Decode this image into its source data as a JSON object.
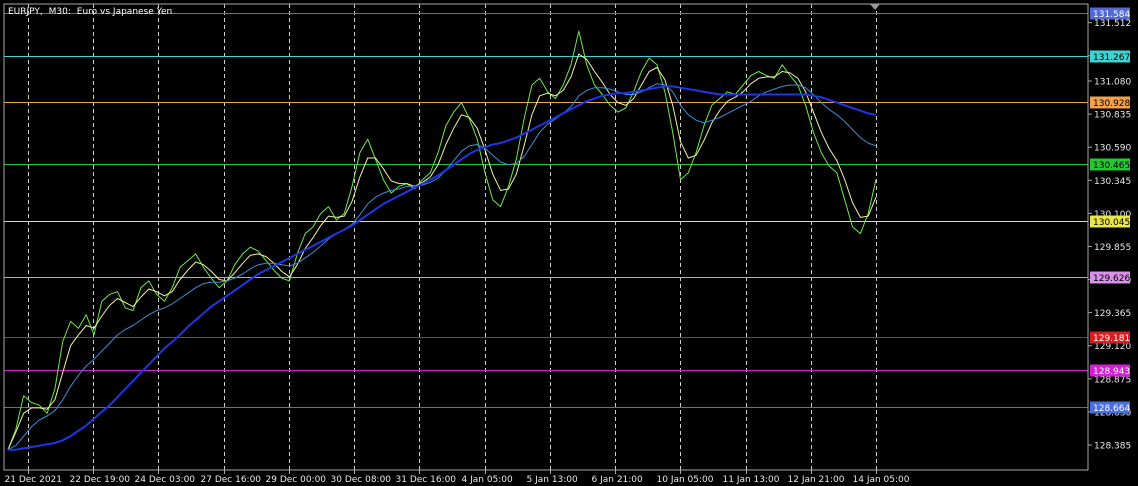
{
  "header": {
    "symbol": "EURJPY,",
    "timeframe": "M30:",
    "description": "Euro vs Japanese Yen"
  },
  "chart_data": {
    "type": "line",
    "ylim": [
      128.2,
      131.65
    ],
    "grid": true,
    "background": "#000000",
    "y_ticks": [
      "131.512",
      "131.267",
      "131.080",
      "130.835",
      "130.590",
      "130.345",
      "130.100",
      "129.855",
      "129.610",
      "129.365",
      "129.120",
      "128.875",
      "128.630",
      "128.385"
    ],
    "x_ticks": [
      "21 Dec 2021",
      "22 Dec 19:00",
      "24 Dec 03:00",
      "27 Dec 16:00",
      "29 Dec 00:00",
      "30 Dec 08:00",
      "31 Dec 16:00",
      "4 Jan 05:00",
      "5 Jan 13:00",
      "6 Jan 21:00",
      "10 Jan 05:00",
      "11 Jan 13:00",
      "12 Jan 21:00",
      "14 Jan 05:00"
    ],
    "levels": [
      {
        "value": 131.584,
        "label": "131.584",
        "color": "#5468d6",
        "text_color": "#ffffff"
      },
      {
        "value": 131.267,
        "label": "131.267",
        "color": "#3fd3d3",
        "text_color": "#000000"
      },
      {
        "value": 130.928,
        "label": "130.928",
        "color": "#f3a14a",
        "text_color": "#000000"
      },
      {
        "value": 130.465,
        "label": "130.465",
        "color": "#27c634",
        "text_color": "#000000"
      },
      {
        "value": 130.045,
        "label": "130.045",
        "color": "#e8e64a",
        "text_color": "#000000"
      },
      {
        "value": 129.626,
        "label": "129.626",
        "color": "#d892ea",
        "text_color": "#000000"
      },
      {
        "value": 129.181,
        "label": "129.181",
        "color": "#d42020",
        "text_color": "#ffffff"
      },
      {
        "value": 128.943,
        "label": "128.943",
        "color": "#d61ed6",
        "text_color": "#ffffff"
      },
      {
        "value": 128.664,
        "label": "128.664",
        "color": "#4a6ee0",
        "text_color": "#ffffff"
      }
    ],
    "series": [
      {
        "color": "#6ee84a",
        "values": [
          128.35,
          128.5,
          128.75,
          128.7,
          128.68,
          128.62,
          128.8,
          129.15,
          129.3,
          129.25,
          129.35,
          129.2,
          129.45,
          129.5,
          129.52,
          129.4,
          129.38,
          129.55,
          129.6,
          129.5,
          129.45,
          129.55,
          129.7,
          129.75,
          129.8,
          129.7,
          129.62,
          129.55,
          129.6,
          129.72,
          129.8,
          129.85,
          129.82,
          129.75,
          129.68,
          129.62,
          129.6,
          129.8,
          129.95,
          130.0,
          130.1,
          130.15,
          130.05,
          130.1,
          130.3,
          130.55,
          130.65,
          130.5,
          130.35,
          130.25,
          130.3,
          130.32,
          130.28,
          130.35,
          130.4,
          130.55,
          130.75,
          130.85,
          130.92,
          130.8,
          130.65,
          130.4,
          130.2,
          130.15,
          130.3,
          130.5,
          130.8,
          131.05,
          131.1,
          131.0,
          130.95,
          131.05,
          131.2,
          131.45,
          131.2,
          131.05,
          130.98,
          130.9,
          130.85,
          130.88,
          131.0,
          131.15,
          131.25,
          131.2,
          131.0,
          130.7,
          130.35,
          130.4,
          130.55,
          130.75,
          130.9,
          130.95,
          131.0,
          130.98,
          131.05,
          131.12,
          131.15,
          131.12,
          131.1,
          131.2,
          131.12,
          131.05,
          130.9,
          130.7,
          130.55,
          130.45,
          130.4,
          130.2,
          130.0,
          129.95,
          130.1,
          130.35
        ]
      },
      {
        "color": "#f2f2a0",
        "values": [
          128.35,
          128.48,
          128.62,
          128.66,
          128.66,
          128.65,
          128.72,
          128.92,
          129.12,
          129.2,
          129.27,
          129.25,
          129.34,
          129.42,
          129.47,
          129.44,
          129.41,
          129.48,
          129.54,
          129.52,
          129.49,
          129.52,
          129.61,
          129.68,
          129.74,
          129.72,
          129.67,
          129.61,
          129.6,
          129.66,
          129.73,
          129.79,
          129.8,
          129.78,
          129.73,
          129.67,
          129.63,
          129.72,
          129.84,
          129.92,
          130.01,
          130.08,
          130.07,
          130.08,
          130.19,
          130.37,
          130.51,
          130.51,
          130.43,
          130.34,
          130.32,
          130.32,
          130.3,
          130.33,
          130.37,
          130.46,
          130.61,
          130.73,
          130.83,
          130.81,
          130.73,
          130.57,
          130.39,
          130.27,
          130.28,
          130.39,
          130.6,
          130.83,
          130.97,
          130.99,
          130.97,
          131.01,
          131.11,
          131.28,
          131.24,
          131.15,
          131.07,
          130.98,
          130.92,
          130.9,
          130.95,
          131.05,
          131.15,
          131.18,
          131.09,
          130.9,
          130.63,
          130.51,
          130.53,
          130.64,
          130.77,
          130.86,
          130.93,
          130.96,
          131.0,
          131.06,
          131.1,
          131.11,
          131.11,
          131.15,
          131.14,
          131.1,
          131.0,
          130.85,
          130.7,
          130.58,
          130.49,
          130.35,
          130.18,
          130.07,
          130.08,
          130.22
        ]
      },
      {
        "color": "#3b8fd8",
        "values": [
          128.35,
          128.38,
          128.45,
          128.52,
          128.57,
          128.6,
          128.64,
          128.72,
          128.82,
          128.9,
          128.97,
          129.02,
          129.08,
          129.14,
          129.2,
          129.24,
          129.27,
          129.31,
          129.35,
          129.38,
          129.4,
          129.43,
          129.47,
          129.51,
          129.55,
          129.58,
          129.59,
          129.59,
          129.6,
          129.62,
          129.65,
          129.69,
          129.72,
          129.73,
          129.73,
          129.72,
          129.71,
          129.73,
          129.77,
          129.81,
          129.86,
          129.91,
          129.95,
          129.98,
          130.02,
          130.09,
          130.17,
          130.22,
          130.25,
          130.27,
          130.28,
          130.3,
          130.3,
          130.31,
          130.33,
          130.36,
          130.42,
          130.49,
          130.56,
          130.6,
          130.61,
          130.58,
          130.53,
          130.48,
          130.46,
          130.47,
          130.52,
          130.61,
          130.7,
          130.76,
          130.8,
          130.84,
          130.89,
          130.97,
          131.01,
          131.03,
          131.03,
          131.02,
          131.0,
          130.98,
          130.98,
          131.0,
          131.03,
          131.06,
          131.05,
          131.0,
          130.9,
          130.83,
          130.79,
          130.77,
          130.79,
          130.81,
          130.84,
          130.87,
          130.9,
          130.93,
          130.97,
          131.0,
          131.02,
          131.04,
          131.05,
          131.05,
          131.03,
          130.98,
          130.92,
          130.87,
          130.83,
          130.78,
          130.72,
          130.66,
          130.62,
          130.6
        ]
      },
      {
        "color": "#1f36e6",
        "values": [
          128.35,
          128.35,
          128.36,
          128.37,
          128.38,
          128.39,
          128.4,
          128.42,
          128.45,
          128.49,
          128.53,
          128.58,
          128.63,
          128.68,
          128.74,
          128.8,
          128.86,
          128.92,
          128.98,
          129.04,
          129.1,
          129.15,
          129.2,
          129.26,
          129.31,
          129.36,
          129.41,
          129.45,
          129.49,
          129.53,
          129.57,
          129.61,
          129.65,
          129.68,
          129.71,
          129.74,
          129.77,
          129.8,
          129.83,
          129.86,
          129.89,
          129.92,
          129.95,
          129.98,
          130.01,
          130.05,
          130.09,
          130.13,
          130.17,
          130.2,
          130.23,
          130.26,
          130.29,
          130.32,
          130.35,
          130.38,
          130.42,
          130.46,
          130.5,
          130.54,
          130.57,
          130.59,
          130.61,
          130.62,
          130.64,
          130.66,
          130.69,
          130.72,
          130.75,
          130.78,
          130.81,
          130.84,
          130.87,
          130.9,
          130.93,
          130.95,
          130.97,
          130.98,
          130.99,
          130.99,
          131.0,
          131.01,
          131.02,
          131.03,
          131.04,
          131.04,
          131.03,
          131.02,
          131.01,
          131.0,
          130.99,
          130.98,
          130.98,
          130.98,
          130.98,
          130.98,
          130.98,
          130.98,
          130.98,
          130.98,
          130.98,
          130.98,
          130.98,
          130.97,
          130.96,
          130.94,
          130.92,
          130.9,
          130.88,
          130.86,
          130.84,
          130.83
        ]
      }
    ]
  }
}
